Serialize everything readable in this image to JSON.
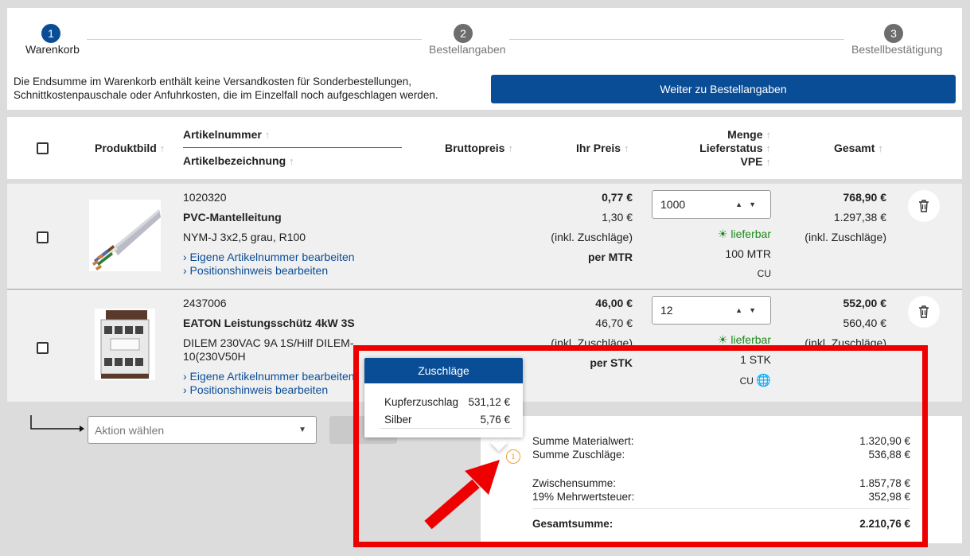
{
  "steps": [
    {
      "number": "1",
      "label": "Warenkorb",
      "active": true
    },
    {
      "number": "2",
      "label": "Bestellangaben",
      "active": false
    },
    {
      "number": "3",
      "label": "Bestellbestätigung",
      "active": false
    }
  ],
  "notice": "Die Endsumme im Warenkorb enthält keine Versandkosten für Sonderbestellungen, Schnittkostenpauschale oder Anfuhrkosten, die im Einzelfall noch aufgeschlagen werden.",
  "continue_button": "Weiter zu Bestellangaben",
  "columns": {
    "image": "Produktbild",
    "article_number": "Artikelnummer",
    "article_name": "Artikelbezeichnung",
    "gross_price": "Bruttopreis",
    "your_price": "Ihr Preis",
    "quantity": "Menge",
    "delivery_status": "Lieferstatus",
    "vpe": "VPE",
    "total": "Gesamt",
    "sort_arrow": "↑"
  },
  "items": [
    {
      "number": "1020320",
      "name": "PVC-Mantelleitung",
      "description": "NYM-J 3x2,5 grau, R100",
      "link_article": "› Eigene Artikelnummer bearbeiten",
      "link_position": "› Positionshinweis bearbeiten",
      "price": "0,77 €",
      "price2": "1,30 €",
      "surcharge_note": "(inkl. Zuschläge)",
      "unit": "per MTR",
      "quantity": "1000",
      "availability": "lieferbar",
      "vpe": "100 MTR",
      "tag": "CU",
      "total": "768,90 €",
      "total2": "1.297,38 €",
      "total_note": "(inkl. Zuschläge)"
    },
    {
      "number": "2437006",
      "name": "EATON Leistungsschütz 4kW 3S",
      "description_line1": "DILEM 230VAC 9A 1S/Hilf DILEM-",
      "description_line2": "10(230V50H",
      "link_article": "› Eigene Artikelnummer bearbeiten",
      "link_position": "› Positionshinweis bearbeiten",
      "price": "46,00 €",
      "price2": "46,70 €",
      "surcharge_note": "(inkl. Zuschläge)",
      "unit": "per STK",
      "quantity": "12",
      "availability": "lieferbar",
      "vpe": "1 STK",
      "tag": "CU",
      "total": "552,00 €",
      "total2": "560,40 €",
      "total_note": "(inkl. Zuschläge)"
    }
  ],
  "action_select_placeholder": "Aktion wählen",
  "summary": {
    "material_label": "Summe Materialwert:",
    "material_value": "1.320,90 €",
    "surcharge_label": "Summe Zuschläge:",
    "surcharge_value": "536,88 €",
    "subtotal_label": "Zwischensumme:",
    "subtotal_value": "1.857,78 €",
    "vat_label": "19% Mehrwertsteuer:",
    "vat_value": "352,98 €",
    "grand_label": "Gesamtsumme:",
    "grand_value": "2.210,76 €"
  },
  "popover": {
    "title": "Zuschläge",
    "rows": [
      {
        "label": "Kupferzuschlag",
        "value": "531,12 €"
      },
      {
        "label": "Silber",
        "value": "5,76 €"
      }
    ]
  },
  "colors": {
    "primary": "#0a4d97",
    "available": "#1a8a1a",
    "annotation": "#ee0000",
    "info_icon": "#e8a13a"
  }
}
